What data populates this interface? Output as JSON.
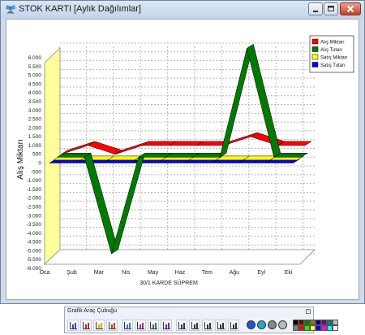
{
  "window": {
    "title": "STOK KARTI [Aylık Dağılımlar]",
    "controls": [
      "minimize",
      "maximize",
      "close"
    ]
  },
  "chart_data": {
    "type": "line",
    "style": "3d-ribbon",
    "categories": [
      "Oca",
      "Şub",
      "Mar",
      "Nis",
      "May",
      "Haz",
      "Tem",
      "Ağu",
      "Eyl",
      "Eki"
    ],
    "series": [
      {
        "name": "Alış Miktarı",
        "color": "#ff0000",
        "values": [
          0,
          500,
          0,
          500,
          500,
          500,
          500,
          1000,
          500,
          500
        ]
      },
      {
        "name": "Alış Tutarı",
        "color": "#007a00",
        "values": [
          0,
          0,
          -5500,
          0,
          0,
          0,
          0,
          6200,
          0,
          0
        ]
      },
      {
        "name": "Satış Miktarı",
        "color": "#ffff00",
        "values": [
          0,
          0,
          0,
          0,
          0,
          0,
          0,
          0,
          0,
          0
        ]
      },
      {
        "name": "Satış Tutarı",
        "color": "#0000ff",
        "values": [
          0,
          0,
          0,
          0,
          0,
          0,
          0,
          0,
          0,
          0
        ]
      }
    ],
    "y_ticks": [
      "6.000",
      "5.500",
      "5.000",
      "4.500",
      "4.000",
      "3.500",
      "3.000",
      "2.500",
      "2.000",
      "1.500",
      "1.000",
      "500",
      "0",
      "-500",
      "-1.000",
      "-1.500",
      "-2.000",
      "-2.500",
      "-3.000",
      "-3.500",
      "-4.000",
      "-4.500",
      "-5.000",
      "-5.500",
      "-6.000"
    ],
    "ylabel": "Alış Miktarı",
    "xlabel": "30/1 KARDE SÜPREM",
    "ylim": [
      -6000,
      6000
    ],
    "grid": true,
    "legend_position": "top-right"
  },
  "toolbar": {
    "title": "Grafik Araç Çubuğu",
    "buttons": [
      {
        "name": "bar-chart-icon",
        "color": "#2a4fb3"
      },
      {
        "name": "column-chart-icon",
        "color": "#b32a2a"
      },
      {
        "name": "pie-chart-icon",
        "color": "#e0a800"
      },
      {
        "name": "pie-3d-icon",
        "color": "#c04000"
      },
      {
        "name": "line-chart-icon",
        "color": "#2a7fb3"
      },
      {
        "name": "area-chart-icon",
        "color": "#b32a6d"
      },
      {
        "name": "trend-line-icon",
        "color": "#2a7f3a"
      },
      {
        "name": "star-chart-icon",
        "color": "#6a2ab3"
      },
      {
        "name": "chart-3d-icon",
        "color": "#3a3a3a"
      },
      {
        "name": "grid-icon",
        "color": "#333333"
      },
      {
        "name": "column-grid-icon",
        "color": "#333333"
      },
      {
        "name": "row-grid-icon",
        "color": "#333333"
      },
      {
        "name": "table-grid-icon",
        "color": "#333333"
      }
    ],
    "circle_buttons": [
      "#2255cc",
      "#22aacc",
      "#888888",
      "#bbbbbb"
    ],
    "palette": [
      "#000000",
      "#7f0000",
      "#007f00",
      "#7f7f00",
      "#00007f",
      "#7f007f",
      "#007f7f",
      "#c0c0c0",
      "#808080",
      "#ff0000",
      "#00ff00",
      "#ffff00",
      "#0000ff",
      "#ff00ff",
      "#00ffff",
      "#ffffff"
    ]
  }
}
